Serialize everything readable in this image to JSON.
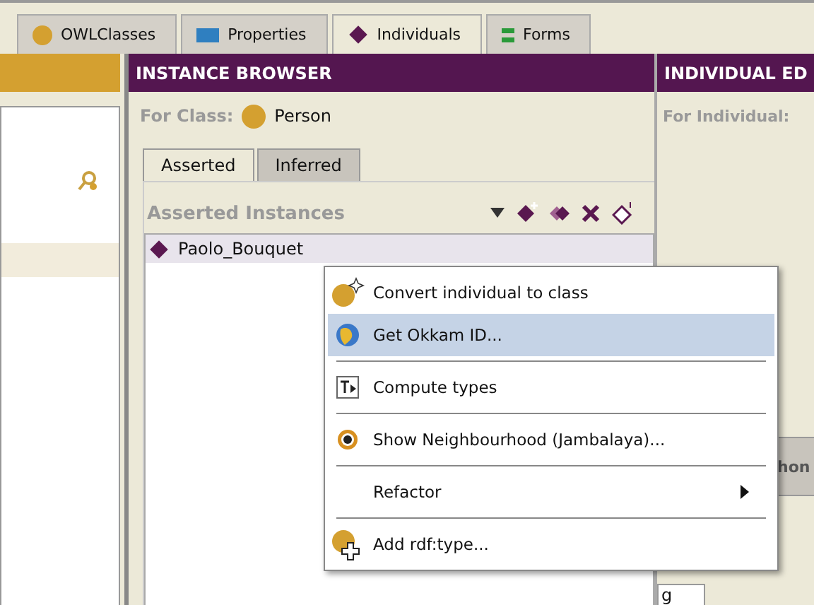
{
  "tabs": [
    {
      "label": "OWLClasses",
      "selected": false
    },
    {
      "label": "Properties",
      "selected": false
    },
    {
      "label": "Individuals",
      "selected": true
    },
    {
      "label": "Forms",
      "selected": false
    }
  ],
  "instance_browser": {
    "title": "INSTANCE BROWSER",
    "for_class_label": "For Class:",
    "for_class": "Person",
    "tabs": [
      {
        "label": "Asserted",
        "selected": true
      },
      {
        "label": "Inferred",
        "selected": false
      }
    ],
    "list_title": "Asserted Instances",
    "instances": [
      {
        "name": "Paolo_Bouquet",
        "selected": true
      }
    ]
  },
  "individual_editor": {
    "title": "INDIVIDUAL ED",
    "for_individual_label": "For Individual:",
    "column_1": "hon",
    "column_2": "g"
  },
  "context_menu": [
    {
      "kind": "item",
      "label": "Convert individual to class",
      "selected": false
    },
    {
      "kind": "item",
      "label": "Get Okkam ID...",
      "selected": true
    },
    {
      "kind": "separator"
    },
    {
      "kind": "item",
      "label": "Compute types",
      "selected": false
    },
    {
      "kind": "separator"
    },
    {
      "kind": "item",
      "label": "Show Neighbourhood (Jambalaya)...",
      "selected": false
    },
    {
      "kind": "separator"
    },
    {
      "kind": "submenu",
      "label": "Refactor",
      "selected": false
    },
    {
      "kind": "separator"
    },
    {
      "kind": "item",
      "label": "Add rdf:type...",
      "selected": false
    }
  ]
}
